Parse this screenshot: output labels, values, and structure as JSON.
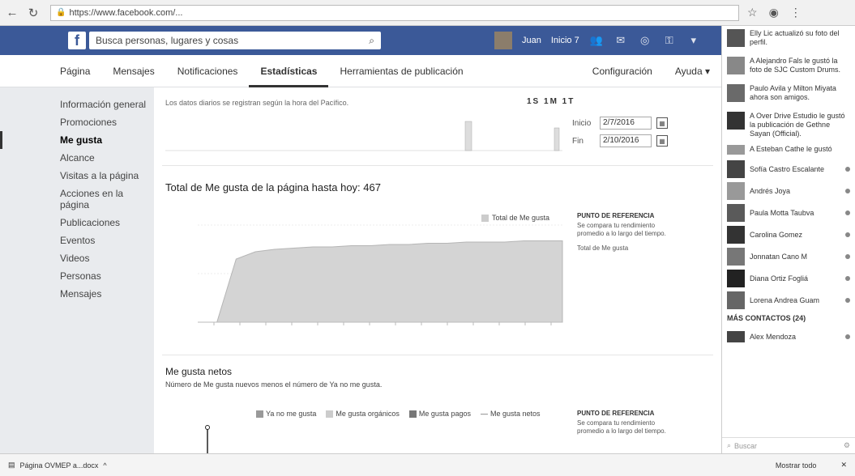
{
  "browser": {
    "url": "https://www.facebook.com/..."
  },
  "fb_header": {
    "search_placeholder": "Busca personas, lugares y cosas",
    "user_name": "Juan",
    "home_label": "Inicio 7"
  },
  "page_nav": {
    "tabs": [
      "Página",
      "Mensajes",
      "Notificaciones",
      "Estadísticas",
      "Herramientas de publicación"
    ],
    "active_tab": "Estadísticas",
    "config_label": "Configuración",
    "help_label": "Ayuda ▾"
  },
  "left_nav": {
    "items": [
      "Información general",
      "Promociones",
      "Me gusta",
      "Alcance",
      "Visitas a la página",
      "Acciones en la página",
      "Publicaciones",
      "Eventos",
      "Videos",
      "Personas",
      "Mensajes"
    ],
    "active": "Me gusta"
  },
  "main": {
    "note": "Los datos diarios se registran según la hora del Pacífico.",
    "range_options": "1S 1M 1T",
    "start_label": "Inicio",
    "start_date": "2/7/2016",
    "end_label": "Fin",
    "end_date": "2/10/2016",
    "total_title": "Total de Me gusta de la página hasta hoy: 467",
    "total_legend": "Total de Me gusta",
    "ref_heading": "PUNTO DE REFERENCIA",
    "ref_text": "Se compara tu rendimiento promedio a lo largo del tiempo.",
    "ref_metric": "Total de Me gusta",
    "net_title": "Me gusta netos",
    "net_desc": "Número de Me gusta nuevos menos el número de Ya no me gusta.",
    "net_legend": [
      "Ya no me gusta",
      "Me gusta orgánicos",
      "Me gusta pagos",
      "Me gusta netos"
    ],
    "ref2_heading": "PUNTO DE REFERENCIA",
    "ref2_text": "Se compara tu rendimiento promedio a lo largo del tiempo."
  },
  "chart_data": {
    "type": "area",
    "series": [
      {
        "name": "Total de Me gusta",
        "values": [
          400,
          400,
          452,
          458,
          460,
          461,
          462,
          462,
          463,
          463,
          464,
          464,
          465,
          465,
          466,
          466,
          466,
          467,
          467,
          467
        ]
      }
    ],
    "ylim": [
      400,
      480
    ]
  },
  "right_col": {
    "notifications": [
      "Elly Lic actualizó su foto del perfil.",
      "A Alejandro Fals le gustó la foto de SJC Custom Drums.",
      "Paulo Avila y Milton Miyata ahora son amigos.",
      "A Over Drive Estudio le gustó la publicación de Gethne Sayan (Official).",
      "A Esteban Cathe le gustó"
    ],
    "contacts": [
      "Sofía Castro Escalante",
      "Andrés Joya",
      "Paula Motta Taubva",
      "Carolina Gomez",
      "Jonnatan Cano M",
      "Diana Ortiz Fogliá",
      "Lorena Andrea Guam"
    ],
    "more_header": "MÁS CONTACTOS (24)",
    "extra_contact": "Alex Mendoza",
    "chat_search": "Buscar"
  },
  "download_bar": {
    "file": "Página OVMEP a...docx",
    "show_all": "Mostrar todo"
  }
}
